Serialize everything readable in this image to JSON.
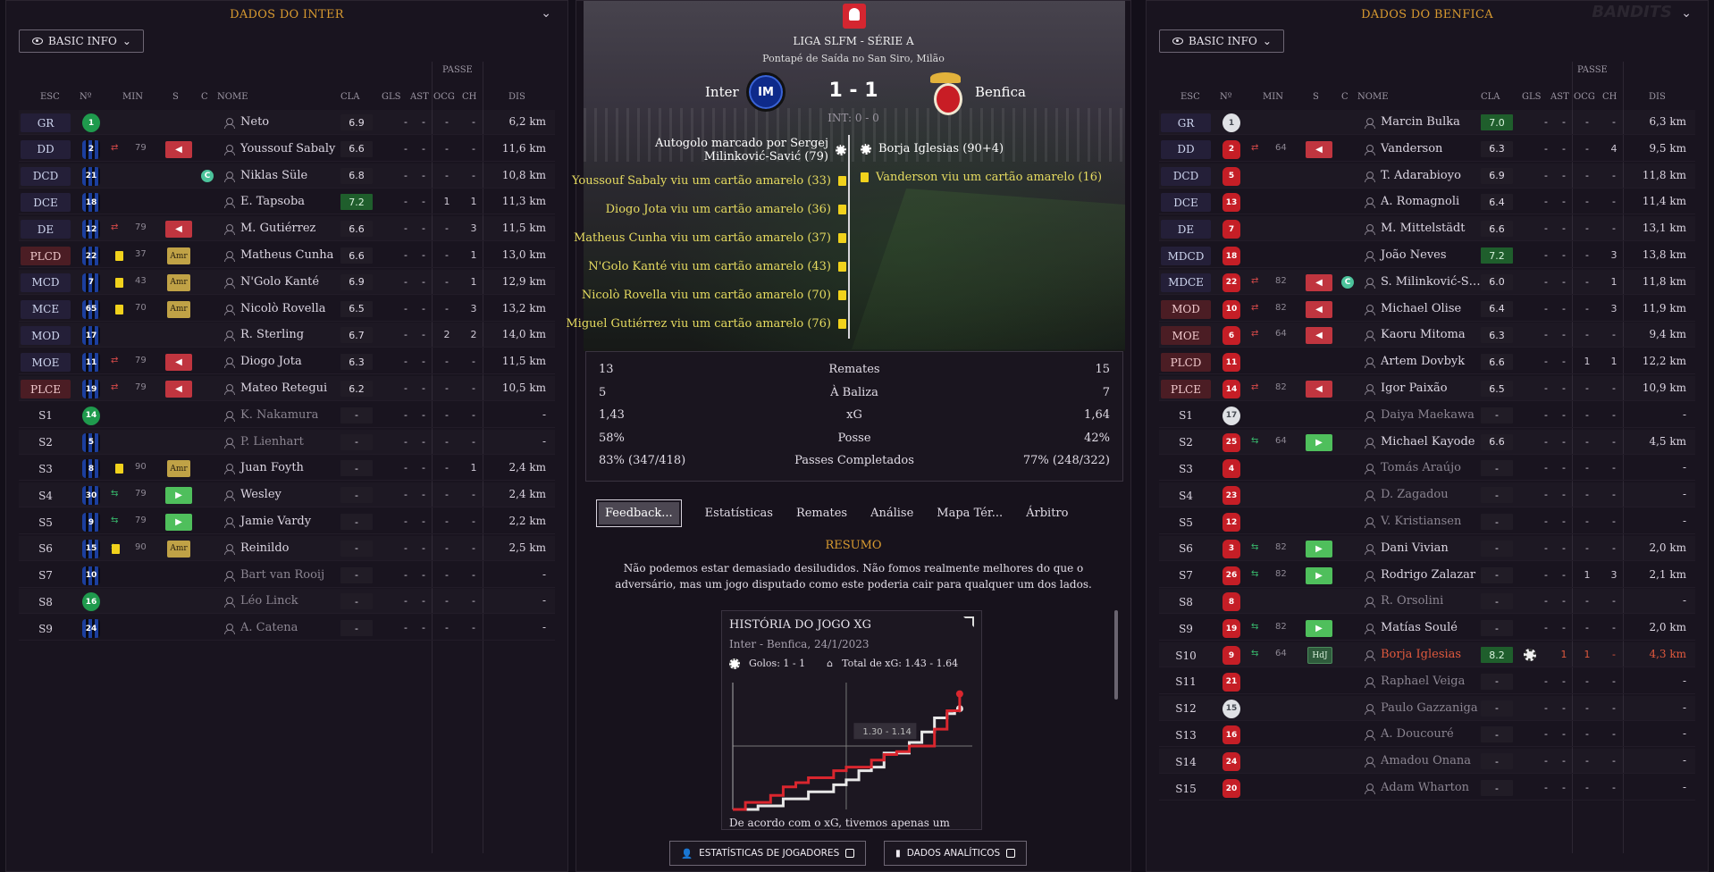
{
  "left": {
    "title": "DADOS DO INTER",
    "view": "BASIC INFO",
    "passe": "PASSE",
    "headers": {
      "esc": "ESC",
      "n": "Nº",
      "min": "MIN",
      "s": "S",
      "c": "C",
      "nome": "NOME",
      "cla": "CLA",
      "gls": "GLS",
      "ast": "AST",
      "ocg": "OCG",
      "ch": "CH",
      "dis": "DIS"
    },
    "rows": [
      {
        "pos": "GR",
        "num": "1",
        "kit": "gk-green",
        "name": "Neto",
        "rating": "6.9",
        "gls": "-",
        "ast": "-",
        "ocg": "-",
        "ch": "-",
        "dis": "6,2 km"
      },
      {
        "pos": "DD",
        "num": "2",
        "kit": "inter",
        "sub": "out",
        "min": "79",
        "btn": "off",
        "name": "Youssouf Sabaly",
        "rating": "6.6",
        "gls": "-",
        "ast": "-",
        "ocg": "-",
        "ch": "-",
        "dis": "11,6 km"
      },
      {
        "pos": "DCD",
        "num": "21",
        "kit": "inter",
        "captain": "C",
        "name": "Niklas Süle",
        "rating": "6.8",
        "gls": "-",
        "ast": "-",
        "ocg": "-",
        "ch": "-",
        "dis": "10,8 km"
      },
      {
        "pos": "DCE",
        "num": "18",
        "kit": "inter",
        "name": "E. Tapsoba",
        "rating": "7.2",
        "rg": true,
        "gls": "-",
        "ast": "-",
        "ocg": "1",
        "ch": "1",
        "dis": "11,3 km"
      },
      {
        "pos": "DE",
        "num": "12",
        "kit": "inter",
        "sub": "out",
        "min": "79",
        "btn": "off",
        "name": "M. Gutiérrez",
        "rating": "6.6",
        "gls": "-",
        "ast": "-",
        "ocg": "-",
        "ch": "3",
        "dis": "11,5 km"
      },
      {
        "pos": "PLCD",
        "num": "22",
        "kit": "inter",
        "red": true,
        "card": true,
        "min": "37",
        "btn": "amr",
        "name": "Matheus Cunha",
        "rating": "6.6",
        "gls": "-",
        "ast": "-",
        "ocg": "-",
        "ch": "1",
        "dis": "13,0 km"
      },
      {
        "pos": "MCD",
        "num": "7",
        "kit": "inter",
        "card": true,
        "min": "43",
        "btn": "amr",
        "name": "N'Golo Kanté",
        "rating": "6.9",
        "gls": "-",
        "ast": "-",
        "ocg": "-",
        "ch": "1",
        "dis": "12,9 km"
      },
      {
        "pos": "MCE",
        "num": "65",
        "kit": "inter",
        "card": true,
        "min": "70",
        "btn": "amr",
        "name": "Nicolò Rovella",
        "rating": "6.5",
        "gls": "-",
        "ast": "-",
        "ocg": "-",
        "ch": "3",
        "dis": "13,2 km"
      },
      {
        "pos": "MOD",
        "num": "17",
        "kit": "inter",
        "name": "R. Sterling",
        "rating": "6.7",
        "gls": "-",
        "ast": "-",
        "ocg": "2",
        "ch": "2",
        "dis": "14,0 km"
      },
      {
        "pos": "MOE",
        "num": "11",
        "kit": "inter",
        "sub": "out",
        "min": "79",
        "btn": "off",
        "name": "Diogo Jota",
        "rating": "6.3",
        "gls": "-",
        "ast": "-",
        "ocg": "-",
        "ch": "-",
        "dis": "11,5 km"
      },
      {
        "pos": "PLCE",
        "num": "19",
        "kit": "inter",
        "red": true,
        "sub": "out",
        "min": "79",
        "btn": "off",
        "name": "Mateo Retegui",
        "rating": "6.2",
        "gls": "-",
        "ast": "-",
        "ocg": "-",
        "ch": "-",
        "dis": "10,5 km"
      },
      {
        "pos": "S1",
        "num": "14",
        "kit": "gk-green",
        "name": "K. Nakamura",
        "dim": true,
        "rating": "-",
        "gls": "-",
        "ast": "-",
        "ocg": "-",
        "ch": "-",
        "dis": "-"
      },
      {
        "pos": "S2",
        "num": "5",
        "kit": "inter",
        "name": "P. Lienhart",
        "dim": true,
        "rating": "-",
        "gls": "-",
        "ast": "-",
        "ocg": "-",
        "ch": "-",
        "dis": "-"
      },
      {
        "pos": "S3",
        "num": "8",
        "kit": "inter",
        "card": true,
        "min": "90",
        "btn": "amr",
        "name": "Juan Foyth",
        "rating": "-",
        "gls": "-",
        "ast": "-",
        "ocg": "-",
        "ch": "1",
        "dis": "2,4 km"
      },
      {
        "pos": "S4",
        "num": "30",
        "kit": "inter",
        "sub": "in",
        "min": "79",
        "btn": "on",
        "name": "Wesley",
        "rating": "-",
        "gls": "-",
        "ast": "-",
        "ocg": "-",
        "ch": "-",
        "dis": "2,4 km"
      },
      {
        "pos": "S5",
        "num": "9",
        "kit": "inter",
        "sub": "in",
        "min": "79",
        "btn": "on",
        "name": "Jamie Vardy",
        "rating": "-",
        "gls": "-",
        "ast": "-",
        "ocg": "-",
        "ch": "-",
        "dis": "2,2 km"
      },
      {
        "pos": "S6",
        "num": "15",
        "kit": "inter",
        "sub": "in",
        "card": true,
        "min": "90",
        "btn": "amr",
        "name": "Reinildo",
        "rating": "-",
        "gls": "-",
        "ast": "-",
        "ocg": "-",
        "ch": "-",
        "dis": "2,5 km"
      },
      {
        "pos": "S7",
        "num": "10",
        "kit": "inter",
        "name": "Bart van Rooij",
        "dim": true,
        "rating": "-",
        "gls": "-",
        "ast": "-",
        "ocg": "-",
        "ch": "-",
        "dis": "-"
      },
      {
        "pos": "S8",
        "num": "16",
        "kit": "gk-green",
        "name": "Léo Linck",
        "dim": true,
        "rating": "-",
        "gls": "-",
        "ast": "-",
        "ocg": "-",
        "ch": "-",
        "dis": "-"
      },
      {
        "pos": "S9",
        "num": "24",
        "kit": "inter",
        "name": "A. Catena",
        "dim": true,
        "rating": "-",
        "gls": "-",
        "ast": "-",
        "ocg": "-",
        "ch": "-",
        "dis": "-"
      }
    ]
  },
  "right": {
    "title": "DADOS DO BENFICA",
    "view": "BASIC INFO",
    "passe": "PASSE",
    "headers": {
      "esc": "ESC",
      "n": "Nº",
      "min": "MIN",
      "s": "S",
      "c": "C",
      "nome": "NOME",
      "cla": "CLA",
      "gls": "GLS",
      "ast": "AST",
      "ocg": "OCG",
      "ch": "CH",
      "dis": "DIS"
    },
    "rows": [
      {
        "pos": "GR",
        "num": "1",
        "kit": "gk-white",
        "name": "Marcin Bulka",
        "rating": "7.0",
        "rg": true,
        "gls": "-",
        "ast": "-",
        "ocg": "-",
        "ch": "-",
        "dis": "6,3 km"
      },
      {
        "pos": "DD",
        "num": "2",
        "kit": "benfica",
        "sub": "out",
        "min": "64",
        "btn": "off",
        "name": "Vanderson",
        "rating": "6.3",
        "gls": "-",
        "ast": "-",
        "ocg": "-",
        "ch": "4",
        "dis": "9,5 km"
      },
      {
        "pos": "DCD",
        "num": "5",
        "kit": "benfica",
        "name": "T. Adarabioyo",
        "rating": "6.9",
        "gls": "-",
        "ast": "-",
        "ocg": "-",
        "ch": "-",
        "dis": "11,8 km"
      },
      {
        "pos": "DCE",
        "num": "13",
        "kit": "benfica",
        "name": "A. Romagnoli",
        "rating": "6.4",
        "gls": "-",
        "ast": "-",
        "ocg": "-",
        "ch": "-",
        "dis": "11,4 km"
      },
      {
        "pos": "DE",
        "num": "7",
        "kit": "benfica",
        "name": "M. Mittelstädt",
        "rating": "6.6",
        "gls": "-",
        "ast": "-",
        "ocg": "-",
        "ch": "-",
        "dis": "13,1 km"
      },
      {
        "pos": "MDCD",
        "num": "18",
        "kit": "benfica",
        "name": "João Neves",
        "rating": "7.2",
        "rg": true,
        "gls": "-",
        "ast": "-",
        "ocg": "-",
        "ch": "3",
        "dis": "13,8 km"
      },
      {
        "pos": "MDCE",
        "num": "22",
        "kit": "benfica",
        "sub": "out",
        "min": "82",
        "btn": "off",
        "captain": "C",
        "name": "S. Milinković-S…",
        "rating": "6.0",
        "gls": "-",
        "ast": "-",
        "ocg": "-",
        "ch": "1",
        "dis": "11,8 km"
      },
      {
        "pos": "MOD",
        "num": "10",
        "kit": "benfica",
        "red": true,
        "sub": "out",
        "min": "82",
        "btn": "off",
        "name": "Michael Olise",
        "rating": "6.4",
        "gls": "-",
        "ast": "-",
        "ocg": "-",
        "ch": "3",
        "dis": "11,9 km"
      },
      {
        "pos": "MOE",
        "num": "6",
        "kit": "benfica",
        "red": true,
        "sub": "out",
        "min": "64",
        "btn": "off",
        "name": "Kaoru Mitoma",
        "rating": "6.3",
        "gls": "-",
        "ast": "-",
        "ocg": "-",
        "ch": "-",
        "dis": "9,4 km"
      },
      {
        "pos": "PLCD",
        "num": "11",
        "kit": "benfica",
        "red": true,
        "name": "Artem Dovbyk",
        "rating": "6.6",
        "gls": "-",
        "ast": "-",
        "ocg": "1",
        "ch": "1",
        "dis": "12,2 km"
      },
      {
        "pos": "PLCE",
        "num": "14",
        "kit": "benfica",
        "red": true,
        "sub": "out",
        "min": "82",
        "btn": "off",
        "name": "Igor Paixão",
        "rating": "6.5",
        "gls": "-",
        "ast": "-",
        "ocg": "-",
        "ch": "-",
        "dis": "10,9 km"
      },
      {
        "pos": "S1",
        "num": "17",
        "kit": "gk-white",
        "name": "Daiya Maekawa",
        "dim": true,
        "rating": "-",
        "gls": "-",
        "ast": "-",
        "ocg": "-",
        "ch": "-",
        "dis": "-"
      },
      {
        "pos": "S2",
        "num": "25",
        "kit": "benfica",
        "sub": "in",
        "min": "64",
        "btn": "on",
        "name": "Michael Kayode",
        "rating": "6.6",
        "gls": "-",
        "ast": "-",
        "ocg": "-",
        "ch": "-",
        "dis": "4,5 km"
      },
      {
        "pos": "S3",
        "num": "4",
        "kit": "benfica",
        "name": "Tomás Araújo",
        "dim": true,
        "rating": "-",
        "gls": "-",
        "ast": "-",
        "ocg": "-",
        "ch": "-",
        "dis": "-"
      },
      {
        "pos": "S4",
        "num": "23",
        "kit": "benfica",
        "name": "D. Zagadou",
        "dim": true,
        "rating": "-",
        "gls": "-",
        "ast": "-",
        "ocg": "-",
        "ch": "-",
        "dis": "-"
      },
      {
        "pos": "S5",
        "num": "12",
        "kit": "benfica",
        "name": "V. Kristiansen",
        "dim": true,
        "rating": "-",
        "gls": "-",
        "ast": "-",
        "ocg": "-",
        "ch": "-",
        "dis": "-"
      },
      {
        "pos": "S6",
        "num": "3",
        "kit": "benfica",
        "sub": "in",
        "min": "82",
        "btn": "on",
        "name": "Dani Vivian",
        "rating": "-",
        "gls": "-",
        "ast": "-",
        "ocg": "-",
        "ch": "-",
        "dis": "2,0 km"
      },
      {
        "pos": "S7",
        "num": "26",
        "kit": "benfica",
        "sub": "in",
        "min": "82",
        "btn": "on",
        "name": "Rodrigo Zalazar",
        "rating": "-",
        "gls": "-",
        "ast": "-",
        "ocg": "1",
        "ch": "3",
        "dis": "2,1 km"
      },
      {
        "pos": "S8",
        "num": "8",
        "kit": "benfica",
        "name": "R. Orsolini",
        "dim": true,
        "rating": "-",
        "gls": "-",
        "ast": "-",
        "ocg": "-",
        "ch": "-",
        "dis": "-"
      },
      {
        "pos": "S9",
        "num": "19",
        "kit": "benfica",
        "sub": "in",
        "min": "82",
        "btn": "on",
        "name": "Matías Soulé",
        "rating": "-",
        "gls": "-",
        "ast": "-",
        "ocg": "-",
        "ch": "-",
        "dis": "2,0 km"
      },
      {
        "pos": "S10",
        "num": "9",
        "kit": "benfica",
        "hl": true,
        "sub": "in",
        "min": "64",
        "btn": "hdj",
        "goal": true,
        "name": "Borja Iglesias",
        "rating": "8.2",
        "rg": true,
        "gls": "-",
        "ast": "1",
        "ocg": "1",
        "ch": "-",
        "dis": "4,3 km"
      },
      {
        "pos": "S11",
        "num": "21",
        "kit": "benfica",
        "name": "Raphael Veiga",
        "dim": true,
        "rating": "-",
        "gls": "-",
        "ast": "-",
        "ocg": "-",
        "ch": "-",
        "dis": "-"
      },
      {
        "pos": "S12",
        "num": "15",
        "kit": "gk-white",
        "name": "Paulo Gazzaniga",
        "dim": true,
        "rating": "-",
        "gls": "-",
        "ast": "-",
        "ocg": "-",
        "ch": "-",
        "dis": "-"
      },
      {
        "pos": "S13",
        "num": "16",
        "kit": "benfica",
        "name": "A. Doucouré",
        "dim": true,
        "rating": "-",
        "gls": "-",
        "ast": "-",
        "ocg": "-",
        "ch": "-",
        "dis": "-"
      },
      {
        "pos": "S14",
        "num": "24",
        "kit": "benfica",
        "name": "Amadou Onana",
        "dim": true,
        "rating": "-",
        "gls": "-",
        "ast": "-",
        "ocg": "-",
        "ch": "-",
        "dis": "-"
      },
      {
        "pos": "S15",
        "num": "20",
        "kit": "benfica",
        "name": "Adam Wharton",
        "dim": true,
        "rating": "-",
        "gls": "-",
        "ast": "-",
        "ocg": "-",
        "ch": "-",
        "dis": "-"
      }
    ]
  },
  "match": {
    "league": "LIGA SLFM - SÉRIE A",
    "kickoff": "Pontapé de Saída no San Siro, Milão",
    "home": "Inter",
    "away": "Benfica",
    "score": "1 - 1",
    "halftime": "INT: 0 - 0",
    "home_events": [
      {
        "text": "Autogolo marcado por Sergej Milinković-Savić (79)",
        "type": "goal"
      },
      {
        "text": "Youssouf Sabaly viu um cartão amarelo (33)",
        "type": "yellow"
      },
      {
        "text": "Diogo Jota viu um cartão amarelo (36)",
        "type": "yellow"
      },
      {
        "text": "Matheus Cunha viu um cartão amarelo (37)",
        "type": "yellow"
      },
      {
        "text": "N'Golo Kanté viu um cartão amarelo (43)",
        "type": "yellow"
      },
      {
        "text": "Nicolò Rovella viu um cartão amarelo (70)",
        "type": "yellow"
      },
      {
        "text": "Miguel Gutiérrez viu um cartão amarelo (76)",
        "type": "yellow"
      }
    ],
    "away_events": [
      {
        "text": "Borja Iglesias (90+4)",
        "type": "goal"
      },
      {
        "text": "Vanderson viu um cartão amarelo (16)",
        "type": "yellow"
      }
    ],
    "stats": [
      {
        "home": "13",
        "label": "Remates",
        "away": "15"
      },
      {
        "home": "5",
        "label": "À Baliza",
        "away": "7"
      },
      {
        "home": "1,43",
        "label": "xG",
        "away": "1,64"
      },
      {
        "home": "58%",
        "label": "Posse",
        "away": "42%"
      },
      {
        "home": "83% (347/418)",
        "label": "Passes Completados",
        "away": "77% (248/322)"
      }
    ],
    "tabs": [
      "Feedback...",
      "Estatísticas",
      "Remates",
      "Análise",
      "Mapa Tér...",
      "Árbitro"
    ],
    "resumo_title": "RESUMO",
    "resumo_text": "Não podemos estar demasiado desiludidos. Não fomos realmente melhores do que o adversário, mas um jogo disputado como este poderia cair para qualquer um dos lados.",
    "xg": {
      "title": "HISTÓRIA DO JOGO XG",
      "subtitle": "Inter - Benfica, 24/1/2023",
      "goals": "Golos: 1 - 1",
      "total": "Total de xG: 1.43 - 1.64",
      "tooltip": "1.30 - 1.14",
      "footer": "De acordo com o xG, tivemos apenas um"
    },
    "buttons": {
      "player_stats": "ESTATÍSTICAS DE JOGADORES",
      "analytics": "DADOS ANALÍTICOS"
    }
  },
  "chart_data": {
    "type": "line",
    "title": "HISTÓRIA DO JOGO XG",
    "xlabel": "",
    "ylabel": "",
    "series": [
      {
        "name": "Inter",
        "color": "#e8e8e8",
        "x": [
          0,
          10,
          20,
          30,
          40,
          45,
          50,
          55,
          60,
          70,
          75,
          80,
          85,
          88,
          90
        ],
        "values": [
          0,
          0.05,
          0.15,
          0.25,
          0.35,
          0.42,
          0.55,
          0.6,
          0.8,
          0.95,
          1.1,
          1.3,
          1.36,
          1.4,
          1.43
        ]
      },
      {
        "name": "Benfica",
        "color": "#d9262e",
        "x": [
          0,
          5,
          15,
          20,
          25,
          30,
          40,
          45,
          55,
          60,
          65,
          70,
          80,
          85,
          90
        ],
        "values": [
          0,
          0.1,
          0.2,
          0.32,
          0.38,
          0.45,
          0.55,
          0.6,
          0.7,
          0.78,
          0.82,
          0.9,
          1.14,
          1.4,
          1.64
        ]
      }
    ],
    "ylim": [
      0,
      1.8
    ],
    "xlim": [
      0,
      95
    ]
  }
}
